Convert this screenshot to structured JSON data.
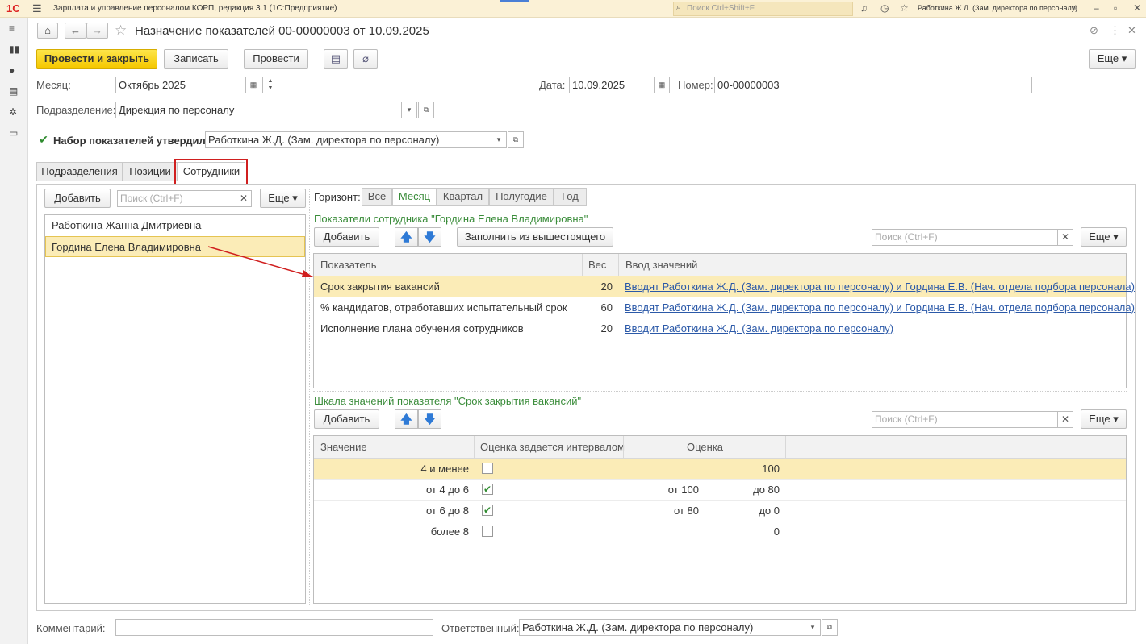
{
  "app": {
    "logo": "1С",
    "title": "Зарплата и управление персоналом КОРП, редакция 3.1  (1С:Предприятие)",
    "search_placeholder": "Поиск Ctrl+Shift+F",
    "user": "Работкина Ж.Д. (Зам. директора по персоналу)"
  },
  "doc": {
    "title": "Назначение показателей 00-00000003 от 10.09.2025",
    "btn_post_close": "Провести и закрыть",
    "btn_write": "Записать",
    "btn_post": "Провести",
    "btn_more": "Еще",
    "month_label": "Месяц:",
    "month_value": "Октябрь 2025",
    "date_label": "Дата:",
    "date_value": "10.09.2025",
    "number_label": "Номер:",
    "number_value": "00-00000003",
    "dept_label": "Подразделение:",
    "dept_value": "Дирекция по персоналу",
    "approved_label": "Набор показателей утвердил",
    "approved_value": "Работкина Ж.Д. (Зам. директора по персоналу)",
    "comment_label": "Комментарий:",
    "comment_value": "",
    "resp_label": "Ответственный:",
    "resp_value": "Работкина Ж.Д. (Зам. директора по персоналу)"
  },
  "tabs": [
    "Подразделения",
    "Позиции",
    "Сотрудники"
  ],
  "left": {
    "add": "Добавить",
    "search_placeholder": "Поиск (Ctrl+F)",
    "more": "Еще",
    "employees": [
      "Работкина Жанна Дмитриевна",
      "Гордина Елена Владимировна"
    ]
  },
  "horizon": {
    "label": "Горизонт:",
    "options": [
      "Все",
      "Месяц",
      "Квартал",
      "Полугодие",
      "Год"
    ],
    "selected": "Месяц"
  },
  "indicators": {
    "heading": "Показатели сотрудника \"Гордина Елена Владимировна\"",
    "add": "Добавить",
    "fill": "Заполнить из вышестоящего",
    "search_placeholder": "Поиск (Ctrl+F)",
    "more": "Еще",
    "col_name": "Показатель",
    "col_weight": "Вес",
    "col_input": "Ввод значений",
    "rows": [
      {
        "name": "Срок закрытия вакансий",
        "weight": "20",
        "input": "Вводят Работкина Ж.Д. (Зам. директора по персоналу) и Гордина Е.В. (Нач. отдела подбора персонала)"
      },
      {
        "name": "% кандидатов, отработавших испытательный срок",
        "weight": "60",
        "input": "Вводят Работкина Ж.Д. (Зам. директора по персоналу) и Гордина Е.В. (Нач. отдела подбора персонала)"
      },
      {
        "name": "Исполнение плана обучения сотрудников",
        "weight": "20",
        "input": "Вводит Работкина Ж.Д. (Зам. директора по персоналу)"
      }
    ]
  },
  "scale": {
    "heading": "Шкала значений показателя \"Срок закрытия вакансий\"",
    "add": "Добавить",
    "search_placeholder": "Поиск (Ctrl+F)",
    "more": "Еще",
    "col_value": "Значение",
    "col_interval": "Оценка задается интервалом",
    "col_score": "Оценка",
    "rows": [
      {
        "value": "4 и менее",
        "interval": false,
        "from": "",
        "to": "100"
      },
      {
        "value": "от 4 до 6",
        "interval": true,
        "from": "от 100",
        "to": "до 80"
      },
      {
        "value": "от 6 до 8",
        "interval": true,
        "from": "от 80",
        "to": "до 0"
      },
      {
        "value": "более 8",
        "interval": false,
        "from": "",
        "to": "0"
      }
    ]
  }
}
